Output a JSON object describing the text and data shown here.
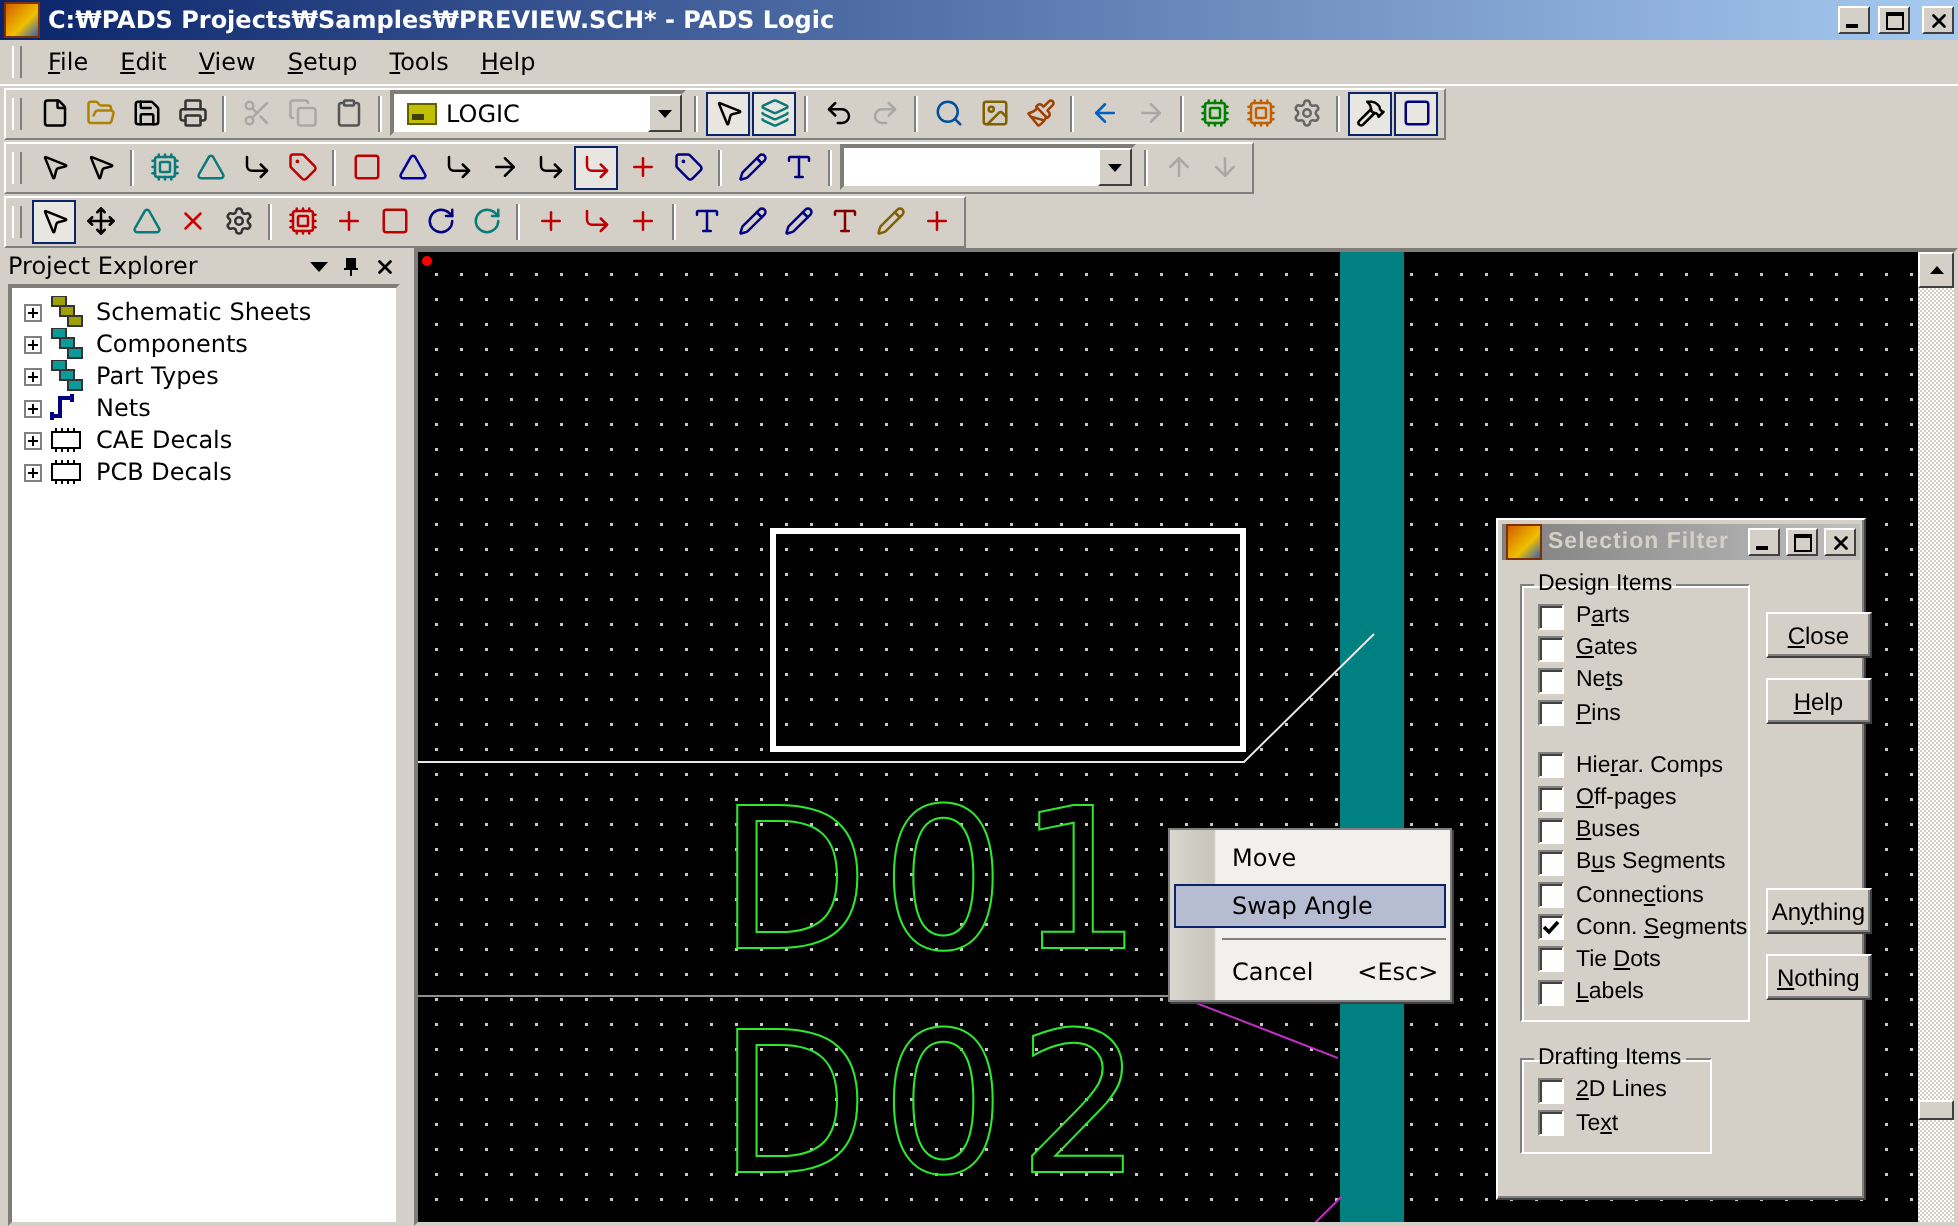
{
  "window": {
    "title": "C:₩PADS Projects₩Samples₩PREVIEW.SCH* - PADS Logic"
  },
  "menu": [
    {
      "label": "File"
    },
    {
      "label": "Edit"
    },
    {
      "label": "View"
    },
    {
      "label": "Setup"
    },
    {
      "label": "Tools"
    },
    {
      "label": "Help"
    }
  ],
  "toolbars": [
    {
      "items": [
        {
          "kind": "button",
          "pressed": false,
          "disabled": false
        },
        {
          "kind": "button",
          "pressed": false,
          "disabled": false
        },
        {
          "kind": "button",
          "pressed": false,
          "disabled": false
        },
        {
          "kind": "button",
          "pressed": false,
          "disabled": false
        },
        {
          "kind": "separator"
        },
        {
          "kind": "button",
          "pressed": false,
          "disabled": true
        },
        {
          "kind": "button",
          "pressed": false,
          "disabled": true
        },
        {
          "kind": "button",
          "pressed": false,
          "disabled": false
        },
        {
          "kind": "separator"
        },
        {
          "kind": "combo",
          "value": "LOGIC"
        },
        {
          "kind": "separator"
        },
        {
          "kind": "button",
          "pressed": true,
          "disabled": false
        },
        {
          "kind": "button",
          "pressed": true,
          "disabled": false
        },
        {
          "kind": "separator"
        },
        {
          "kind": "button",
          "pressed": false,
          "disabled": false
        },
        {
          "kind": "button",
          "pressed": false,
          "disabled": true
        },
        {
          "kind": "separator"
        },
        {
          "kind": "button",
          "pressed": false,
          "disabled": false
        },
        {
          "kind": "button",
          "pressed": false,
          "disabled": false
        },
        {
          "kind": "button",
          "pressed": false,
          "disabled": false
        },
        {
          "kind": "separator"
        },
        {
          "kind": "button",
          "pressed": false,
          "disabled": false
        },
        {
          "kind": "button",
          "pressed": false,
          "disabled": true
        },
        {
          "kind": "separator"
        },
        {
          "kind": "button",
          "pressed": false,
          "disabled": false
        },
        {
          "kind": "button",
          "pressed": false,
          "disabled": false
        },
        {
          "kind": "button",
          "pressed": false,
          "disabled": false
        },
        {
          "kind": "separator"
        },
        {
          "kind": "button",
          "pressed": true,
          "disabled": false
        },
        {
          "kind": "button",
          "pressed": true,
          "disabled": false
        }
      ]
    },
    {
      "items": [
        {
          "kind": "button",
          "pressed": false,
          "disabled": false
        },
        {
          "kind": "button",
          "pressed": false,
          "disabled": false
        },
        {
          "kind": "separator"
        },
        {
          "kind": "button",
          "pressed": false,
          "disabled": false
        },
        {
          "kind": "button",
          "pressed": false,
          "disabled": false
        },
        {
          "kind": "button",
          "pressed": false,
          "disabled": false
        },
        {
          "kind": "button",
          "pressed": false,
          "disabled": false
        },
        {
          "kind": "separator"
        },
        {
          "kind": "button",
          "pressed": false,
          "disabled": false
        },
        {
          "kind": "button",
          "pressed": false,
          "disabled": false
        },
        {
          "kind": "button",
          "pressed": false,
          "disabled": false
        },
        {
          "kind": "button",
          "pressed": false,
          "disabled": false
        },
        {
          "kind": "button",
          "pressed": false,
          "disabled": false
        },
        {
          "kind": "button",
          "pressed": true,
          "disabled": false
        },
        {
          "kind": "button",
          "pressed": false,
          "disabled": false
        },
        {
          "kind": "button",
          "pressed": false,
          "disabled": false
        },
        {
          "kind": "separator"
        },
        {
          "kind": "button",
          "pressed": false,
          "disabled": false
        },
        {
          "kind": "button",
          "pressed": false,
          "disabled": false
        },
        {
          "kind": "separator"
        },
        {
          "kind": "combo",
          "value": ""
        },
        {
          "kind": "separator"
        },
        {
          "kind": "button",
          "pressed": false,
          "disabled": true
        },
        {
          "kind": "button",
          "pressed": false,
          "disabled": true
        }
      ]
    },
    {
      "items": [
        {
          "kind": "button",
          "pressed": true,
          "disabled": false
        },
        {
          "kind": "button",
          "pressed": false,
          "disabled": false
        },
        {
          "kind": "button",
          "pressed": false,
          "disabled": false
        },
        {
          "kind": "button",
          "pressed": false,
          "disabled": false
        },
        {
          "kind": "button",
          "pressed": false,
          "disabled": false
        },
        {
          "kind": "separator"
        },
        {
          "kind": "button",
          "pressed": false,
          "disabled": false
        },
        {
          "kind": "button",
          "pressed": false,
          "disabled": false
        },
        {
          "kind": "button",
          "pressed": false,
          "disabled": false
        },
        {
          "kind": "button",
          "pressed": false,
          "disabled": false
        },
        {
          "kind": "button",
          "pressed": false,
          "disabled": false
        },
        {
          "kind": "separator"
        },
        {
          "kind": "button",
          "pressed": false,
          "disabled": false
        },
        {
          "kind": "button",
          "pressed": false,
          "disabled": false
        },
        {
          "kind": "button",
          "pressed": false,
          "disabled": false
        },
        {
          "kind": "separator"
        },
        {
          "kind": "button",
          "pressed": false,
          "disabled": false
        },
        {
          "kind": "button",
          "pressed": false,
          "disabled": false
        },
        {
          "kind": "button",
          "pressed": false,
          "disabled": false
        },
        {
          "kind": "button",
          "pressed": false,
          "disabled": false
        },
        {
          "kind": "button",
          "pressed": false,
          "disabled": false
        },
        {
          "kind": "button",
          "pressed": false,
          "disabled": false
        }
      ]
    }
  ],
  "explorer": {
    "title": "Project Explorer",
    "items": [
      {
        "label": "Schematic Sheets",
        "expanded": false
      },
      {
        "label": "Components",
        "expanded": false
      },
      {
        "label": "Part Types",
        "expanded": false
      },
      {
        "label": "Nets",
        "expanded": false
      },
      {
        "label": "CAE Decals",
        "expanded": false
      },
      {
        "label": "PCB Decals",
        "expanded": false
      }
    ]
  },
  "canvas": {
    "labels": [
      {
        "text": "D01"
      },
      {
        "text": "D02"
      }
    ]
  },
  "context_menu": {
    "items": [
      {
        "kind": "item",
        "label": "Move",
        "selected": false
      },
      {
        "kind": "item",
        "label": "Swap Angle",
        "selected": true
      },
      {
        "kind": "separator"
      },
      {
        "kind": "item",
        "label": "Cancel",
        "shortcut": "<Esc>",
        "selected": false
      }
    ]
  },
  "selection_filter": {
    "title": "Selection Filter",
    "groups": [
      {
        "title": "Design Items",
        "items": [
          {
            "kind": "check",
            "label": "Parts",
            "checked": false
          },
          {
            "kind": "check",
            "label": "Gates",
            "checked": false
          },
          {
            "kind": "check",
            "label": "Nets",
            "checked": false
          },
          {
            "kind": "check",
            "label": "Pins",
            "checked": false
          },
          {
            "kind": "gap"
          },
          {
            "kind": "check",
            "label": "Hierar. Comps",
            "checked": false
          },
          {
            "kind": "check",
            "label": "Off-pages",
            "checked": false
          },
          {
            "kind": "check",
            "label": "Buses",
            "checked": false
          },
          {
            "kind": "check",
            "label": "Bus Segments",
            "checked": false
          },
          {
            "kind": "check",
            "label": "Connections",
            "checked": false
          },
          {
            "kind": "check",
            "label": "Conn. Segments",
            "checked": true
          },
          {
            "kind": "check",
            "label": "Tie Dots",
            "checked": false
          },
          {
            "kind": "check",
            "label": "Labels",
            "checked": false
          }
        ]
      },
      {
        "title": "Drafting Items",
        "items": [
          {
            "kind": "check",
            "label": "2D Lines",
            "checked": false
          },
          {
            "kind": "check",
            "label": "Text",
            "checked": false
          }
        ]
      }
    ],
    "buttons": [
      {
        "label": "Close"
      },
      {
        "label": "Help"
      },
      {
        "label": "Anything"
      },
      {
        "label": "Nothing"
      }
    ]
  }
}
